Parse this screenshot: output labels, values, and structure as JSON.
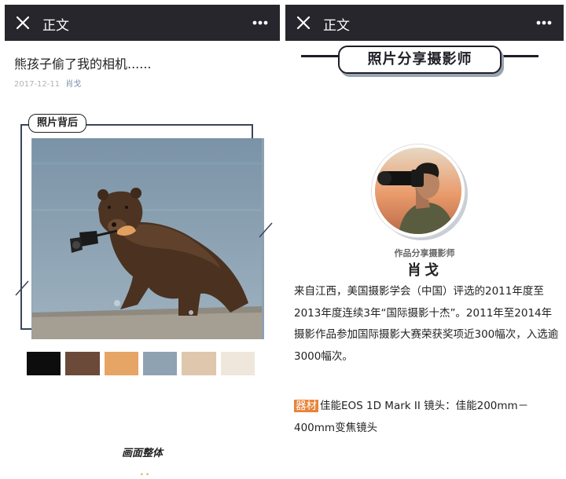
{
  "left": {
    "header": {
      "title": "正文"
    },
    "article": {
      "title": "熊孩子偷了我的相机......",
      "date": "2017-12-11",
      "author": "肖戈"
    },
    "section_label": "照片背后",
    "palette": [
      "#0d0d0d",
      "#6b4a3a",
      "#e6a565",
      "#8fa2b2",
      "#dec7ad",
      "#efe6dc"
    ],
    "caption": "画面整体",
    "bottom_marks": "• •"
  },
  "right": {
    "header": {
      "title": "正文"
    },
    "section_title": "照片分享摄影师",
    "photographer": {
      "role": "作品分享摄影师",
      "name": "肖戈"
    },
    "bio": "来自江西，美国摄影学会（中国）评选的2011年度至2013年度连续3年“国际摄影十杰”。2011年至2014年摄影作品参加国际摄影大赛荣获奖项近300幅次，入选逾3000幅次。",
    "gear_label": "器材",
    "gear_text": "佳能EOS 1D Mark II 镜头：佳能200mm－400mm变焦镜头"
  }
}
